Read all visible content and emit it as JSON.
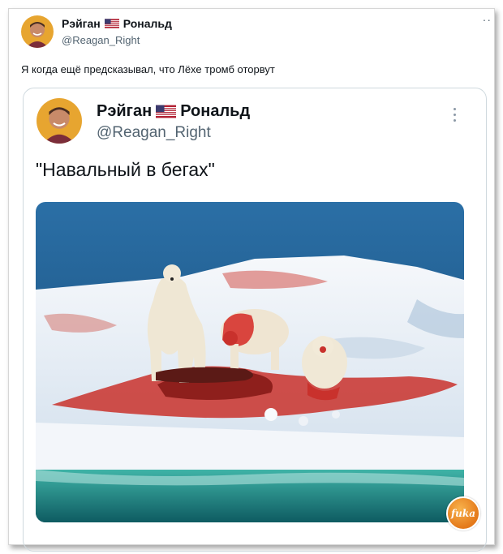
{
  "tweet": {
    "author_name_first": "Рэйган",
    "author_name_last": "Рональд",
    "handle": "@Reagan_Right",
    "text": "Я когда ещё предсказывал, что Лёхе тромб оторвут",
    "more_label": "··"
  },
  "quoted": {
    "author_name_first": "Рэйган",
    "author_name_last": "Рональд",
    "handle": "@Reagan_Right",
    "text": "\"Навальный в бегах\"",
    "image": "polar-bears-on-bloody-ice-photo"
  },
  "watermark": {
    "text": "fuka"
  },
  "colors": {
    "sea": "#1d5a8c",
    "ice": "#eef3f8",
    "blood": "#c9312c",
    "watermark": "#e4791a"
  }
}
